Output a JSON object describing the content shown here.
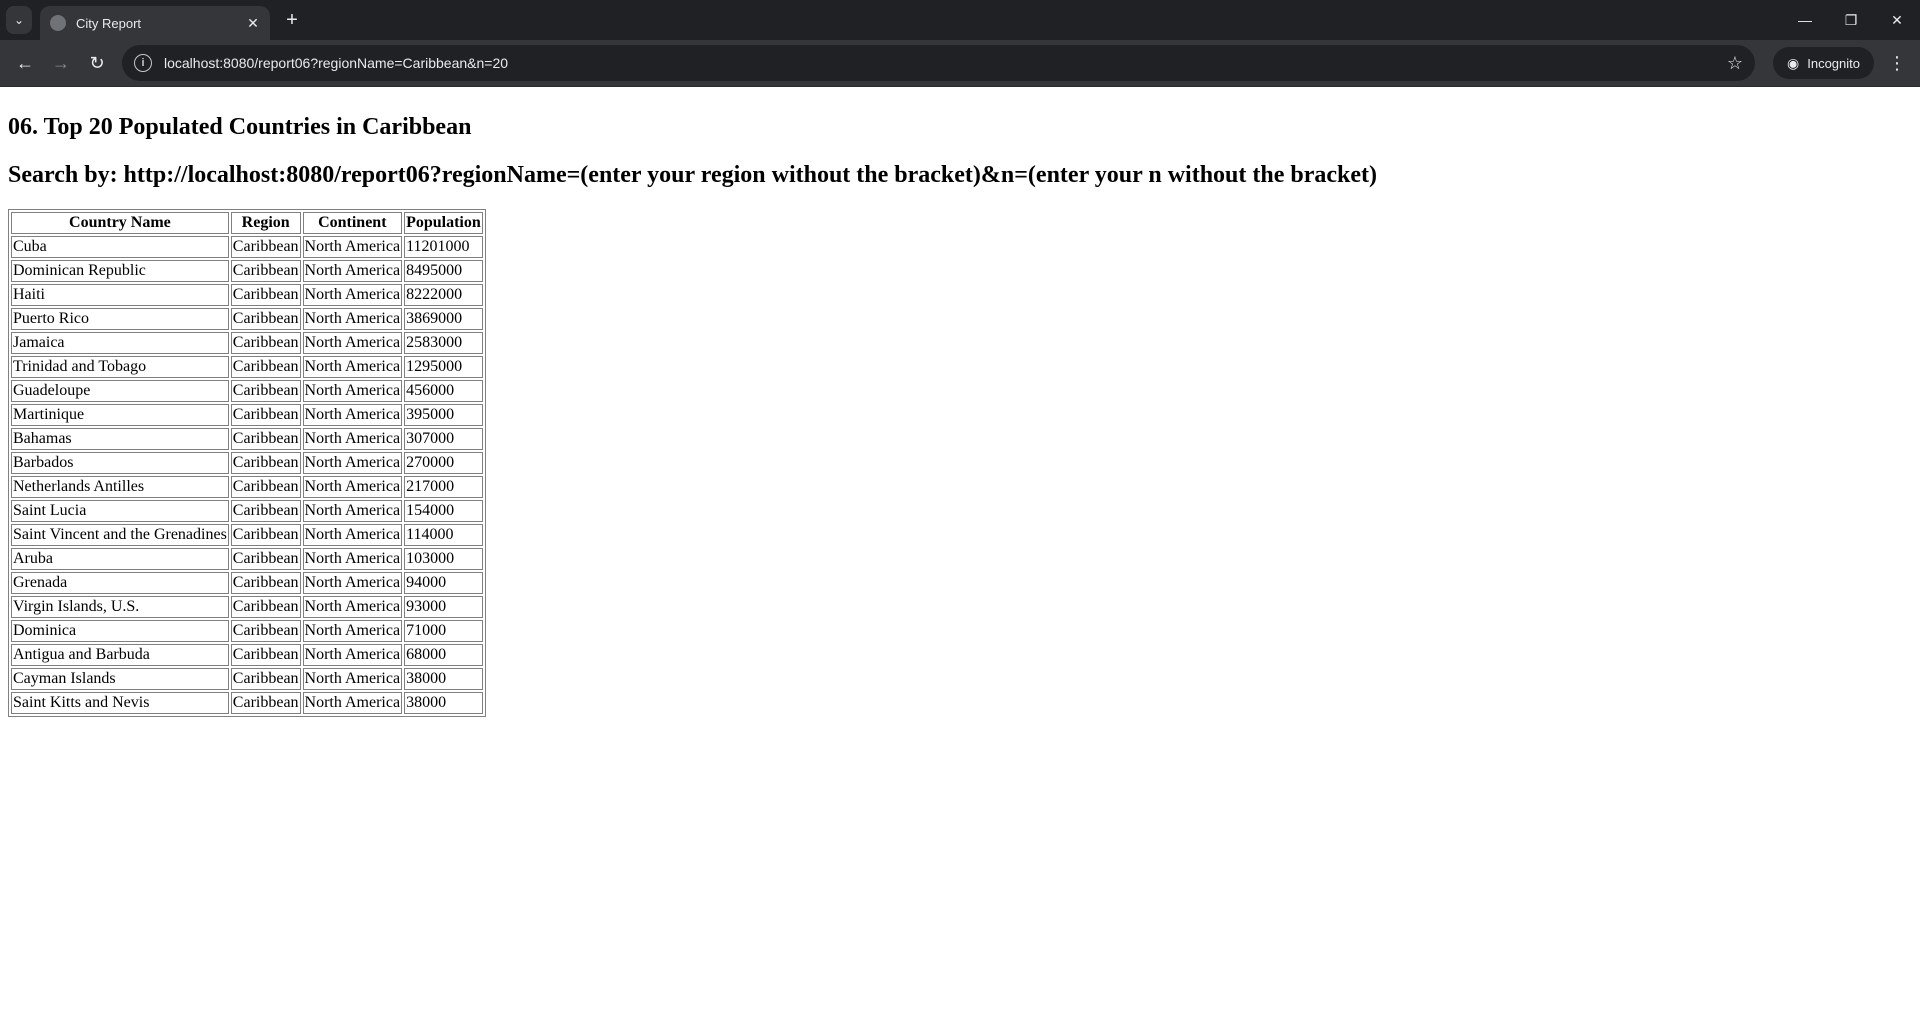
{
  "browser": {
    "tab_title": "City Report",
    "url": "localhost:8080/report06?regionName=Caribbean&n=20",
    "incognito_label": "Incognito"
  },
  "page": {
    "heading": "06. Top 20 Populated Countries in Caribbean",
    "search_hint": "Search by: http://localhost:8080/report06?regionName=(enter your region without the bracket)&n=(enter your n without the bracket)"
  },
  "table": {
    "headers": [
      "Country Name",
      "Region",
      "Continent",
      "Population"
    ],
    "rows": [
      [
        "Cuba",
        "Caribbean",
        "North America",
        "11201000"
      ],
      [
        "Dominican Republic",
        "Caribbean",
        "North America",
        "8495000"
      ],
      [
        "Haiti",
        "Caribbean",
        "North America",
        "8222000"
      ],
      [
        "Puerto Rico",
        "Caribbean",
        "North America",
        "3869000"
      ],
      [
        "Jamaica",
        "Caribbean",
        "North America",
        "2583000"
      ],
      [
        "Trinidad and Tobago",
        "Caribbean",
        "North America",
        "1295000"
      ],
      [
        "Guadeloupe",
        "Caribbean",
        "North America",
        "456000"
      ],
      [
        "Martinique",
        "Caribbean",
        "North America",
        "395000"
      ],
      [
        "Bahamas",
        "Caribbean",
        "North America",
        "307000"
      ],
      [
        "Barbados",
        "Caribbean",
        "North America",
        "270000"
      ],
      [
        "Netherlands Antilles",
        "Caribbean",
        "North America",
        "217000"
      ],
      [
        "Saint Lucia",
        "Caribbean",
        "North America",
        "154000"
      ],
      [
        "Saint Vincent and the Grenadines",
        "Caribbean",
        "North America",
        "114000"
      ],
      [
        "Aruba",
        "Caribbean",
        "North America",
        "103000"
      ],
      [
        "Grenada",
        "Caribbean",
        "North America",
        "94000"
      ],
      [
        "Virgin Islands, U.S.",
        "Caribbean",
        "North America",
        "93000"
      ],
      [
        "Dominica",
        "Caribbean",
        "North America",
        "71000"
      ],
      [
        "Antigua and Barbuda",
        "Caribbean",
        "North America",
        "68000"
      ],
      [
        "Cayman Islands",
        "Caribbean",
        "North America",
        "38000"
      ],
      [
        "Saint Kitts and Nevis",
        "Caribbean",
        "North America",
        "38000"
      ]
    ]
  }
}
